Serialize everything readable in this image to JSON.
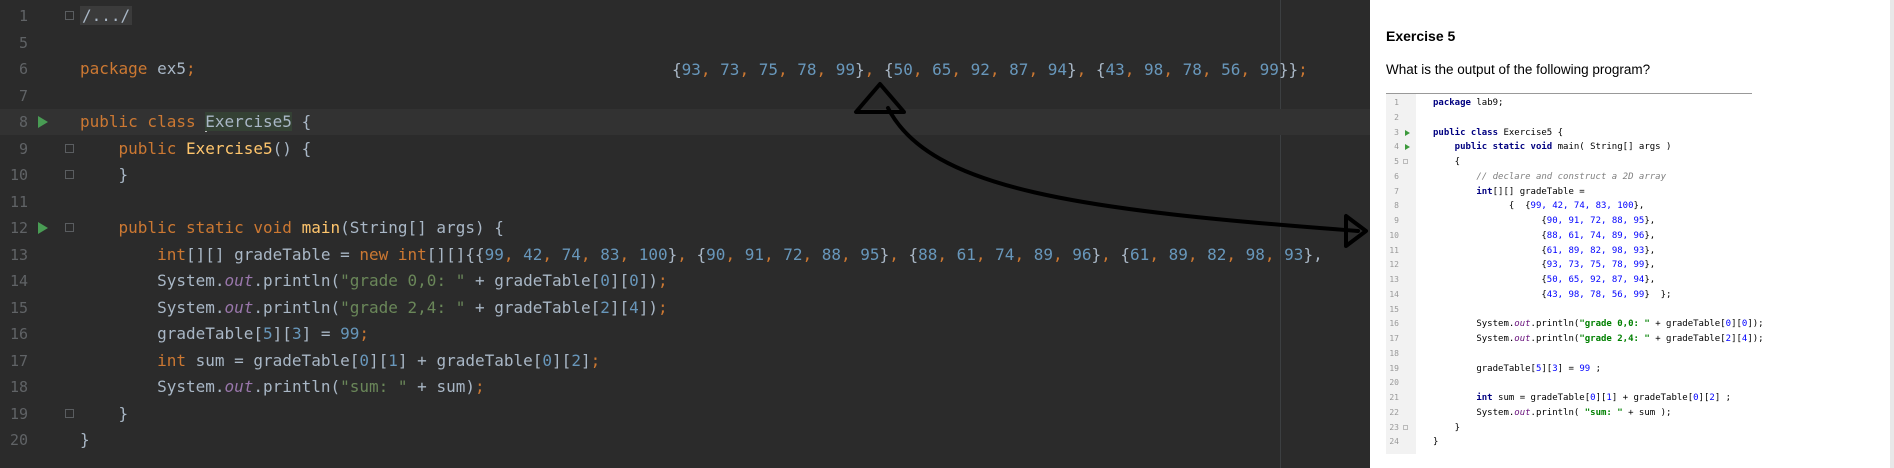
{
  "editor": {
    "lines": [
      {
        "n": "1",
        "tokens": [
          {
            "t": "/.../",
            "c": "fold-text"
          }
        ],
        "fold": true
      },
      {
        "n": "5",
        "tokens": []
      },
      {
        "n": "6",
        "tokens": [
          {
            "t": "package ",
            "c": "kw"
          },
          {
            "t": "ex5",
            "c": ""
          },
          {
            "t": ";",
            "c": "kw"
          }
        ]
      },
      {
        "n": "7",
        "tokens": []
      },
      {
        "n": "8",
        "tokens": [
          {
            "t": "public class ",
            "c": "kw"
          },
          {
            "t": "",
            "c": "caret"
          },
          {
            "t": "Exercise5",
            "c": "hl"
          },
          {
            "t": " {",
            "c": ""
          }
        ],
        "run": true,
        "current": true
      },
      {
        "n": "9",
        "tokens": [
          {
            "t": "    public ",
            "c": "kw"
          },
          {
            "t": "Exercise5",
            "c": "fn"
          },
          {
            "t": "() {",
            "c": ""
          }
        ],
        "fold": true
      },
      {
        "n": "10",
        "tokens": [
          {
            "t": "    }",
            "c": ""
          }
        ],
        "fold": true
      },
      {
        "n": "11",
        "tokens": []
      },
      {
        "n": "12",
        "tokens": [
          {
            "t": "    public static void ",
            "c": "kw"
          },
          {
            "t": "main",
            "c": "fn"
          },
          {
            "t": "(String[] args) {",
            "c": ""
          }
        ],
        "run": true,
        "fold": true
      },
      {
        "n": "13",
        "tokens": [
          {
            "t": "        int",
            "c": "kw"
          },
          {
            "t": "[][] gradeTable = ",
            "c": ""
          },
          {
            "t": "new ",
            "c": "kw"
          },
          {
            "t": "int",
            "c": "kw"
          },
          {
            "t": "[][]{{",
            "c": ""
          },
          {
            "t": "99",
            "c": "num"
          },
          {
            "t": ", ",
            "c": "kw"
          },
          {
            "t": "42",
            "c": "num"
          },
          {
            "t": ", ",
            "c": "kw"
          },
          {
            "t": "74",
            "c": "num"
          },
          {
            "t": ", ",
            "c": "kw"
          },
          {
            "t": "83",
            "c": "num"
          },
          {
            "t": ", ",
            "c": "kw"
          },
          {
            "t": "100",
            "c": "num"
          },
          {
            "t": "}",
            "c": ""
          },
          {
            "t": ", ",
            "c": "kw"
          },
          {
            "t": "{",
            "c": ""
          },
          {
            "t": "90",
            "c": "num"
          },
          {
            "t": ", ",
            "c": "kw"
          },
          {
            "t": "91",
            "c": "num"
          },
          {
            "t": ", ",
            "c": "kw"
          },
          {
            "t": "72",
            "c": "num"
          },
          {
            "t": ", ",
            "c": "kw"
          },
          {
            "t": "88",
            "c": "num"
          },
          {
            "t": ", ",
            "c": "kw"
          },
          {
            "t": "95",
            "c": "num"
          },
          {
            "t": "}",
            "c": ""
          },
          {
            "t": ", ",
            "c": "kw"
          },
          {
            "t": "{",
            "c": ""
          },
          {
            "t": "88",
            "c": "num"
          },
          {
            "t": ", ",
            "c": "kw"
          },
          {
            "t": "61",
            "c": "num"
          },
          {
            "t": ", ",
            "c": "kw"
          },
          {
            "t": "74",
            "c": "num"
          },
          {
            "t": ", ",
            "c": "kw"
          },
          {
            "t": "89",
            "c": "num"
          },
          {
            "t": ", ",
            "c": "kw"
          },
          {
            "t": "96",
            "c": "num"
          },
          {
            "t": "}",
            "c": ""
          },
          {
            "t": ", ",
            "c": "kw"
          },
          {
            "t": "{",
            "c": ""
          },
          {
            "t": "61",
            "c": "num"
          },
          {
            "t": ", ",
            "c": "kw"
          },
          {
            "t": "89",
            "c": "num"
          },
          {
            "t": ", ",
            "c": "kw"
          },
          {
            "t": "82",
            "c": "num"
          },
          {
            "t": ", ",
            "c": "kw"
          },
          {
            "t": "98",
            "c": "num"
          },
          {
            "t": ", ",
            "c": "kw"
          },
          {
            "t": "93",
            "c": "num"
          },
          {
            "t": "},",
            "c": ""
          }
        ]
      },
      {
        "n": "14",
        "tokens": [
          {
            "t": "        System.",
            "c": ""
          },
          {
            "t": "out",
            "c": "stat"
          },
          {
            "t": ".println(",
            "c": ""
          },
          {
            "t": "\"grade 0,0: \"",
            "c": "str"
          },
          {
            "t": " + gradeTable[",
            "c": ""
          },
          {
            "t": "0",
            "c": "num"
          },
          {
            "t": "][",
            "c": ""
          },
          {
            "t": "0",
            "c": "num"
          },
          {
            "t": "])",
            "c": ""
          },
          {
            "t": ";",
            "c": "kw"
          }
        ]
      },
      {
        "n": "15",
        "tokens": [
          {
            "t": "        System.",
            "c": ""
          },
          {
            "t": "out",
            "c": "stat"
          },
          {
            "t": ".println(",
            "c": ""
          },
          {
            "t": "\"grade 2,4: \"",
            "c": "str"
          },
          {
            "t": " + gradeTable[",
            "c": ""
          },
          {
            "t": "2",
            "c": "num"
          },
          {
            "t": "][",
            "c": ""
          },
          {
            "t": "4",
            "c": "num"
          },
          {
            "t": "])",
            "c": ""
          },
          {
            "t": ";",
            "c": "kw"
          }
        ]
      },
      {
        "n": "16",
        "tokens": [
          {
            "t": "        gradeTable[",
            "c": ""
          },
          {
            "t": "5",
            "c": "num"
          },
          {
            "t": "][",
            "c": ""
          },
          {
            "t": "3",
            "c": "num"
          },
          {
            "t": "] = ",
            "c": ""
          },
          {
            "t": "99",
            "c": "num"
          },
          {
            "t": ";",
            "c": "kw"
          }
        ]
      },
      {
        "n": "17",
        "tokens": [
          {
            "t": "        int ",
            "c": "kw"
          },
          {
            "t": "sum = gradeTable[",
            "c": ""
          },
          {
            "t": "0",
            "c": "num"
          },
          {
            "t": "][",
            "c": ""
          },
          {
            "t": "1",
            "c": "num"
          },
          {
            "t": "] + gradeTable[",
            "c": ""
          },
          {
            "t": "0",
            "c": "num"
          },
          {
            "t": "][",
            "c": ""
          },
          {
            "t": "2",
            "c": "num"
          },
          {
            "t": "]",
            "c": ""
          },
          {
            "t": ";",
            "c": "kw"
          }
        ]
      },
      {
        "n": "18",
        "tokens": [
          {
            "t": "        System.",
            "c": ""
          },
          {
            "t": "out",
            "c": "stat"
          },
          {
            "t": ".println(",
            "c": ""
          },
          {
            "t": "\"sum: \"",
            "c": "str"
          },
          {
            "t": " + sum)",
            "c": ""
          },
          {
            "t": ";",
            "c": "kw"
          }
        ]
      },
      {
        "n": "19",
        "tokens": [
          {
            "t": "    }",
            "c": ""
          }
        ],
        "fold": true
      },
      {
        "n": "20",
        "tokens": [
          {
            "t": "}",
            "c": ""
          }
        ]
      }
    ],
    "overflow_tokens": [
      {
        "t": "{",
        "c": ""
      },
      {
        "t": "93",
        "c": "num"
      },
      {
        "t": ", ",
        "c": "kw"
      },
      {
        "t": "73",
        "c": "num"
      },
      {
        "t": ", ",
        "c": "kw"
      },
      {
        "t": "75",
        "c": "num"
      },
      {
        "t": ", ",
        "c": "kw"
      },
      {
        "t": "78",
        "c": "num"
      },
      {
        "t": ", ",
        "c": "kw"
      },
      {
        "t": "99",
        "c": "num"
      },
      {
        "t": "}",
        "c": ""
      },
      {
        "t": ", ",
        "c": "kw"
      },
      {
        "t": "{",
        "c": ""
      },
      {
        "t": "50",
        "c": "num"
      },
      {
        "t": ", ",
        "c": "kw"
      },
      {
        "t": "65",
        "c": "num"
      },
      {
        "t": ", ",
        "c": "kw"
      },
      {
        "t": "92",
        "c": "num"
      },
      {
        "t": ", ",
        "c": "kw"
      },
      {
        "t": "87",
        "c": "num"
      },
      {
        "t": ", ",
        "c": "kw"
      },
      {
        "t": "94",
        "c": "num"
      },
      {
        "t": "}",
        "c": ""
      },
      {
        "t": ", ",
        "c": "kw"
      },
      {
        "t": "{",
        "c": ""
      },
      {
        "t": "43",
        "c": "num"
      },
      {
        "t": ", ",
        "c": "kw"
      },
      {
        "t": "98",
        "c": "num"
      },
      {
        "t": ", ",
        "c": "kw"
      },
      {
        "t": "78",
        "c": "num"
      },
      {
        "t": ", ",
        "c": "kw"
      },
      {
        "t": "56",
        "c": "num"
      },
      {
        "t": ", ",
        "c": "kw"
      },
      {
        "t": "99",
        "c": "num"
      },
      {
        "t": "}}",
        "c": ""
      },
      {
        "t": ";",
        "c": "kw"
      }
    ]
  },
  "panel": {
    "title": "Exercise 5",
    "question": "What is the output of the following program?",
    "lines": [
      {
        "n": "1",
        "tokens": [
          {
            "t": "package ",
            "c": "skw"
          },
          {
            "t": "lab9;",
            "c": ""
          }
        ]
      },
      {
        "n": "2",
        "tokens": []
      },
      {
        "n": "3",
        "tokens": [
          {
            "t": "public class ",
            "c": "skw"
          },
          {
            "t": "Exercise5 {",
            "c": ""
          }
        ],
        "run": true
      },
      {
        "n": "4",
        "tokens": [
          {
            "t": "    public static void ",
            "c": "skw"
          },
          {
            "t": "main( String[] args )",
            "c": ""
          }
        ],
        "run": true
      },
      {
        "n": "5",
        "tokens": [
          {
            "t": "    {",
            "c": ""
          }
        ],
        "fold": true
      },
      {
        "n": "6",
        "tokens": [
          {
            "t": "        // declare and construct a 2D array",
            "c": "scmt"
          }
        ]
      },
      {
        "n": "7",
        "tokens": [
          {
            "t": "        int",
            "c": "skw"
          },
          {
            "t": "[][] gradeTable =",
            "c": ""
          }
        ]
      },
      {
        "n": "8",
        "tokens": [
          {
            "t": "              {  {",
            "c": ""
          },
          {
            "t": "99, 42, 74, 83, 100",
            "c": "snum"
          },
          {
            "t": "},",
            "c": ""
          }
        ]
      },
      {
        "n": "9",
        "tokens": [
          {
            "t": "                    {",
            "c": ""
          },
          {
            "t": "90, 91, 72, 88, 95",
            "c": "snum"
          },
          {
            "t": "},",
            "c": ""
          }
        ]
      },
      {
        "n": "10",
        "tokens": [
          {
            "t": "                    {",
            "c": ""
          },
          {
            "t": "88, 61, 74, 89, 96",
            "c": "snum"
          },
          {
            "t": "},",
            "c": ""
          }
        ]
      },
      {
        "n": "11",
        "tokens": [
          {
            "t": "                    {",
            "c": ""
          },
          {
            "t": "61, 89, 82, 98, 93",
            "c": "snum"
          },
          {
            "t": "},",
            "c": ""
          }
        ]
      },
      {
        "n": "12",
        "tokens": [
          {
            "t": "                    {",
            "c": ""
          },
          {
            "t": "93, 73, 75, 78, 99",
            "c": "snum"
          },
          {
            "t": "},",
            "c": ""
          }
        ]
      },
      {
        "n": "13",
        "tokens": [
          {
            "t": "                    {",
            "c": ""
          },
          {
            "t": "50, 65, 92, 87, 94",
            "c": "snum"
          },
          {
            "t": "},",
            "c": ""
          }
        ]
      },
      {
        "n": "14",
        "tokens": [
          {
            "t": "                    {",
            "c": ""
          },
          {
            "t": "43, 98, 78, 56, 99",
            "c": "snum"
          },
          {
            "t": "}  };",
            "c": ""
          }
        ]
      },
      {
        "n": "15",
        "tokens": []
      },
      {
        "n": "16",
        "tokens": [
          {
            "t": "        System.",
            "c": ""
          },
          {
            "t": "out",
            "c": "sstat"
          },
          {
            "t": ".println(",
            "c": ""
          },
          {
            "t": "\"grade 0,0: \"",
            "c": "sstr"
          },
          {
            "t": " + gradeTable[",
            "c": ""
          },
          {
            "t": "0",
            "c": "snum"
          },
          {
            "t": "][",
            "c": ""
          },
          {
            "t": "0",
            "c": "snum"
          },
          {
            "t": "]);",
            "c": ""
          }
        ]
      },
      {
        "n": "17",
        "tokens": [
          {
            "t": "        System.",
            "c": ""
          },
          {
            "t": "out",
            "c": "sstat"
          },
          {
            "t": ".println(",
            "c": ""
          },
          {
            "t": "\"grade 2,4: \"",
            "c": "sstr"
          },
          {
            "t": " + gradeTable[",
            "c": ""
          },
          {
            "t": "2",
            "c": "snum"
          },
          {
            "t": "][",
            "c": ""
          },
          {
            "t": "4",
            "c": "snum"
          },
          {
            "t": "]);",
            "c": ""
          }
        ]
      },
      {
        "n": "18",
        "tokens": []
      },
      {
        "n": "19",
        "tokens": [
          {
            "t": "        gradeTable[",
            "c": ""
          },
          {
            "t": "5",
            "c": "snum"
          },
          {
            "t": "][",
            "c": ""
          },
          {
            "t": "3",
            "c": "snum"
          },
          {
            "t": "] = ",
            "c": ""
          },
          {
            "t": "99",
            "c": "snum"
          },
          {
            "t": " ;",
            "c": ""
          }
        ]
      },
      {
        "n": "20",
        "tokens": []
      },
      {
        "n": "21",
        "tokens": [
          {
            "t": "        int ",
            "c": "skw"
          },
          {
            "t": "sum = gradeTable[",
            "c": ""
          },
          {
            "t": "0",
            "c": "snum"
          },
          {
            "t": "][",
            "c": ""
          },
          {
            "t": "1",
            "c": "snum"
          },
          {
            "t": "] + gradeTable[",
            "c": ""
          },
          {
            "t": "0",
            "c": "snum"
          },
          {
            "t": "][",
            "c": ""
          },
          {
            "t": "2",
            "c": "snum"
          },
          {
            "t": "] ;",
            "c": ""
          }
        ]
      },
      {
        "n": "22",
        "tokens": [
          {
            "t": "        System.",
            "c": ""
          },
          {
            "t": "out",
            "c": "sstat"
          },
          {
            "t": ".println( ",
            "c": ""
          },
          {
            "t": "\"sum: \"",
            "c": "sstr"
          },
          {
            "t": " + sum );",
            "c": ""
          }
        ]
      },
      {
        "n": "23",
        "tokens": [
          {
            "t": "    }",
            "c": ""
          }
        ],
        "fold": true
      },
      {
        "n": "24",
        "tokens": [
          {
            "t": "}",
            "c": ""
          }
        ]
      }
    ]
  },
  "colors": {
    "run_icon": "#499c54",
    "arrow": "#000000"
  }
}
